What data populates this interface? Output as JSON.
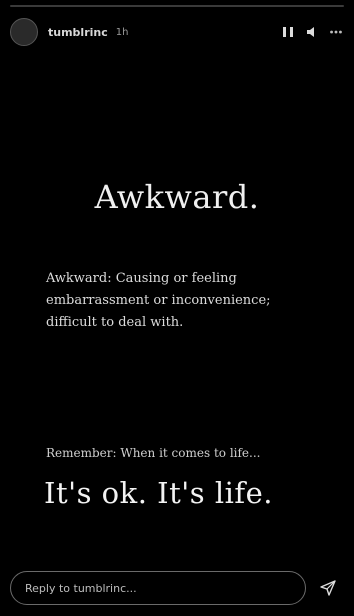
{
  "story": {
    "progress": 0.0
  },
  "header": {
    "username": "tumblrinc",
    "timestamp": "1h",
    "icons": [
      "avatar",
      "pause-icon",
      "mute-icon",
      "more-icon"
    ]
  },
  "content": {
    "title": "Awkward.",
    "body": "Awkward: Causing or feeling embarrassment or inconvenience; difficult to deal with.",
    "quote": "Remember: When it comes to life...",
    "big_line": "It's ok. It's life."
  },
  "footer": {
    "reply_placeholder": "Reply to tumblrinc...",
    "send_icon": "send-icon"
  },
  "colors": {
    "background": "#000000",
    "text": "#e9e9e9",
    "muted": "#9a9a9a",
    "border": "#6a6a6a"
  }
}
